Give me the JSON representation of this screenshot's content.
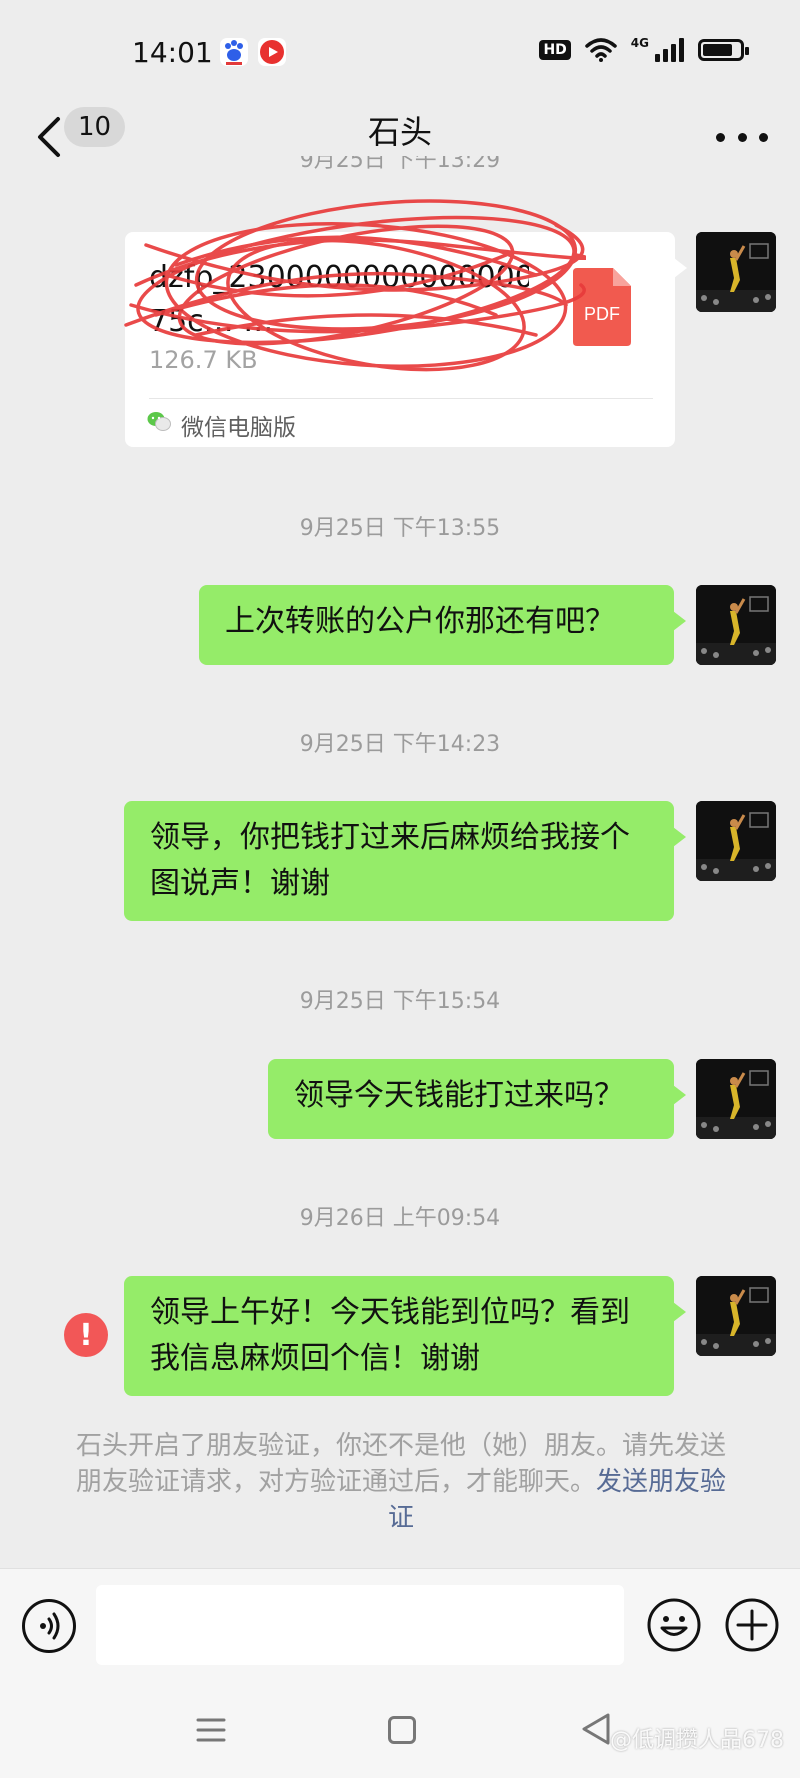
{
  "status_bar": {
    "time": "14:01",
    "hd_label": "HD",
    "network_label": "4G",
    "battery_percent": 80
  },
  "header": {
    "unread_count": "10",
    "title": "石头"
  },
  "partial_timestamp": "9月25日 下午13:29",
  "file_message": {
    "file_name": "dzfp_2300000000000000\n75c… …",
    "file_size": "126.7 KB",
    "file_type": "PDF",
    "source": "微信电脑版"
  },
  "messages": [
    {
      "timestamp": "9月25日 下午13:55",
      "text": "上次转账的公户你那还有吧？"
    },
    {
      "timestamp": "9月25日 下午14:23",
      "text": "领导，你把钱打过来后麻烦给我接个图说声！谢谢"
    },
    {
      "timestamp": "9月25日 下午15:54",
      "text": "领导今天钱能打过来吗？"
    },
    {
      "timestamp": "9月26日 上午09:54",
      "text": "领导上午好！今天钱能到位吗？看到我信息麻烦回个信！谢谢",
      "send_failed": true
    }
  ],
  "notice": {
    "text": "石头开启了朋友验证，你还不是他（她）朋友。请先发送朋友验证请求，对方验证通过后，才能聊天。",
    "link": "发送朋友验证"
  },
  "input_bar": {
    "placeholder": "",
    "icons": [
      "voice-icon",
      "emoji-icon",
      "add-icon"
    ]
  },
  "nav_bar": {
    "icons": [
      "menu-icon",
      "home-icon",
      "back-icon"
    ],
    "watermark": "@低调攒人品678"
  },
  "colors": {
    "background": "#ededed",
    "bubble_self": "#95ec69",
    "error": "#f25757",
    "link": "#576b95",
    "pdf": "#f15a4f",
    "scribble": "#e83b3b"
  }
}
